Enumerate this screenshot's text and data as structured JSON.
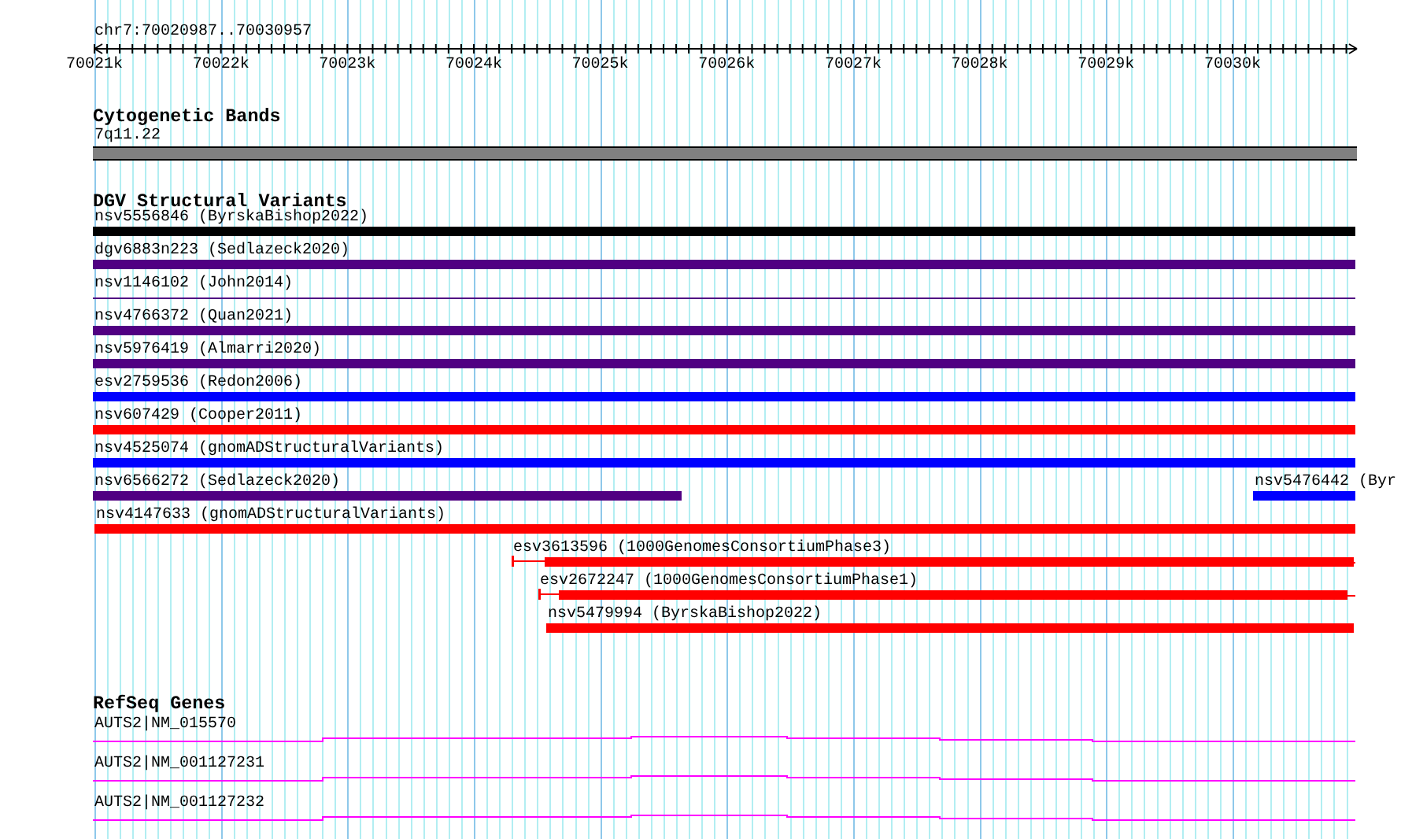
{
  "ruler": {
    "location": "chr7:70020987..70030957",
    "tick_labels": [
      "70021k",
      "70022k",
      "70023k",
      "70024k",
      "70025k",
      "70026k",
      "70027k",
      "70028k",
      "70029k",
      "70030k"
    ]
  },
  "tracks": [
    {
      "kind": "cytoband",
      "title": "Cytogenetic Bands",
      "features": [
        {
          "label": "7q11.22",
          "color": "#808080"
        }
      ]
    },
    {
      "kind": "variants",
      "title": "DGV Structural Variants",
      "rows": [
        [
          {
            "label": "nsv5556846 (ByrskaBishop2022)",
            "color": "#000000"
          }
        ],
        [
          {
            "label": "dgv6883n223 (Sedlazeck2020)",
            "color": "#500082"
          }
        ],
        [
          {
            "label": "nsv1146102 (John2014)",
            "color": "#500082"
          }
        ],
        [
          {
            "label": "nsv4766372 (Quan2021)",
            "color": "#500082"
          }
        ],
        [
          {
            "label": "nsv5976419 (Almarri2020)",
            "color": "#500082"
          }
        ],
        [
          {
            "label": "esv2759536 (Redon2006)",
            "color": "#0000ff"
          }
        ],
        [
          {
            "label": "nsv607429 (Cooper2011)",
            "color": "#ff0000"
          }
        ],
        [
          {
            "label": "nsv4525074 (gnomADStructuralVariants)",
            "color": "#0000ff"
          }
        ],
        [
          {
            "label": "nsv6566272 (Sedlazeck2020)",
            "color": "#500082"
          },
          {
            "label": "nsv5476442 (Byr",
            "color": "#0000ff"
          }
        ],
        [
          {
            "label": "nsv4147633 (gnomADStructuralVariants)",
            "color": "#ff0000"
          }
        ],
        [
          {
            "label": "esv3613596 (1000GenomesConsortiumPhase3)",
            "color": "#ff0000"
          }
        ],
        [
          {
            "label": "esv2672247 (1000GenomesConsortiumPhase1)",
            "color": "#ff0000"
          }
        ],
        [
          {
            "label": "nsv5479994 (ByrskaBishop2022)",
            "color": "#ff0000"
          }
        ]
      ]
    },
    {
      "kind": "genes",
      "title": "RefSeq Genes",
      "features": [
        {
          "label": "AUTS2|NM_015570"
        },
        {
          "label": "AUTS2|NM_001127231"
        },
        {
          "label": "AUTS2|NM_001127232"
        }
      ]
    }
  ]
}
